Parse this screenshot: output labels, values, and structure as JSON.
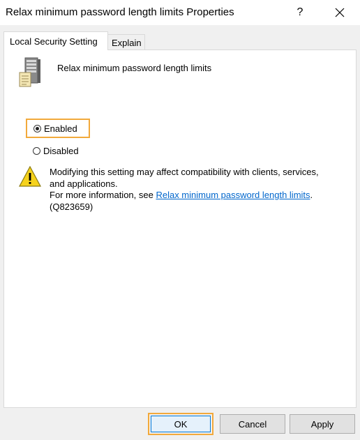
{
  "window": {
    "title": "Relax minimum password length limits Properties",
    "help_label": "?"
  },
  "tabs": [
    {
      "label": "Local Security Setting",
      "active": true
    },
    {
      "label": "Explain",
      "active": false
    }
  ],
  "policy": {
    "name": "Relax minimum password length limits"
  },
  "options": {
    "enabled_label": "Enabled",
    "disabled_label": "Disabled",
    "selected": "Enabled"
  },
  "warning": {
    "line1": "Modifying this setting may affect compatibility with clients, services,",
    "line2": "and applications.",
    "more_info_prefix": "For more information, see ",
    "link_text": "Relax minimum password length limits",
    "link_suffix": ".",
    "kb_ref": "(Q823659)"
  },
  "buttons": {
    "ok": "OK",
    "cancel": "Cancel",
    "apply": "Apply"
  },
  "colors": {
    "highlight": "#f2a93b",
    "link": "#0066cc",
    "focus": "#0078d7"
  }
}
